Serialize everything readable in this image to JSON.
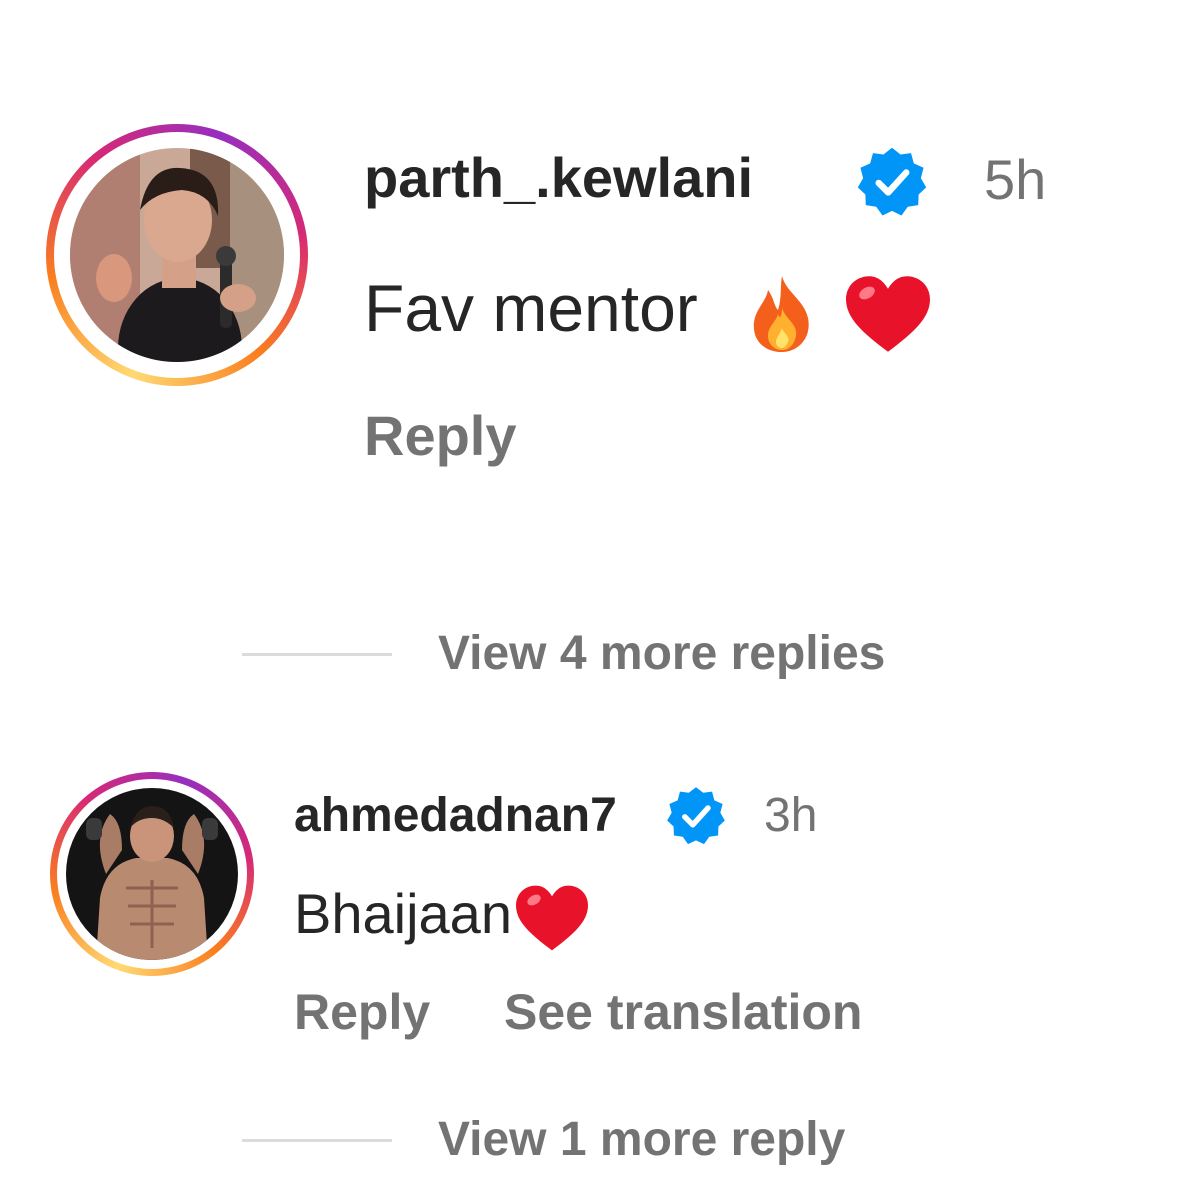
{
  "comments": [
    {
      "username": "parth_.kewlani",
      "verified": true,
      "time": "5h",
      "text": "Fav mentor",
      "emojis": [
        "fire-icon",
        "red-heart-icon"
      ],
      "actions": {
        "reply": "Reply"
      },
      "view_more": "View 4 more replies"
    },
    {
      "username": "ahmedadnan7",
      "verified": true,
      "time": "3h",
      "text": "Bhaijaan",
      "emojis": [
        "red-heart-icon"
      ],
      "actions": {
        "reply": "Reply",
        "translate": "See translation"
      },
      "view_more": "View 1 more reply"
    }
  ],
  "colors": {
    "text": "#262626",
    "secondary": "#737373",
    "verified_badge": "#0095f6",
    "divider": "#dbdbdb"
  }
}
